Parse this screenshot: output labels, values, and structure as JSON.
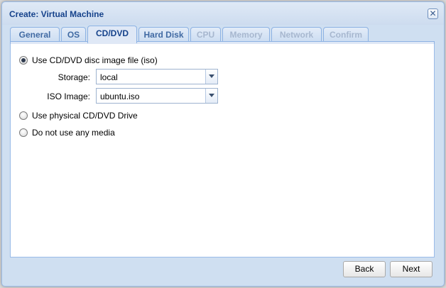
{
  "window": {
    "title": "Create: Virtual Machine",
    "close_glyph": "✕"
  },
  "tabs": [
    {
      "label": "General",
      "state": "enabled"
    },
    {
      "label": "OS",
      "state": "enabled"
    },
    {
      "label": "CD/DVD",
      "state": "active"
    },
    {
      "label": "Hard Disk",
      "state": "enabled"
    },
    {
      "label": "CPU",
      "state": "disabled"
    },
    {
      "label": "Memory",
      "state": "disabled"
    },
    {
      "label": "Network",
      "state": "disabled"
    },
    {
      "label": "Confirm",
      "state": "disabled"
    }
  ],
  "cddvd": {
    "option_iso": {
      "label": "Use CD/DVD disc image file (iso)",
      "checked": true
    },
    "storage": {
      "label": "Storage:",
      "value": "local"
    },
    "iso_image": {
      "label": "ISO Image:",
      "value": "ubuntu.iso"
    },
    "option_physical": {
      "label": "Use physical CD/DVD Drive",
      "checked": false
    },
    "option_none": {
      "label": "Do not use any media",
      "checked": false
    }
  },
  "footer": {
    "back_label": "Back",
    "next_label": "Next"
  }
}
